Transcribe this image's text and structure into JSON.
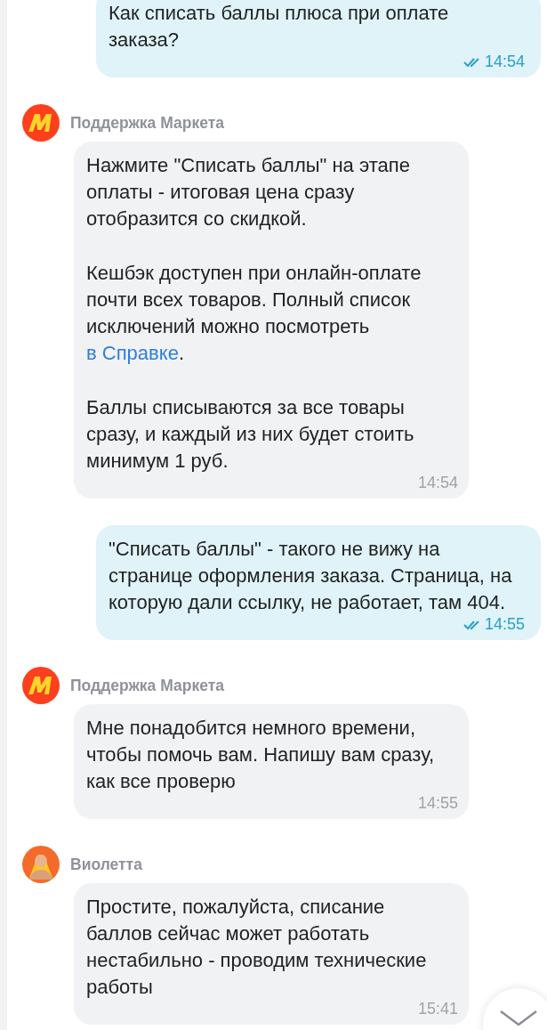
{
  "messages": [
    {
      "kind": "outgoing",
      "paragraphs": [
        [
          {
            "text": "Как списать баллы плюса при оплате заказа?"
          }
        ]
      ],
      "time": "14:54",
      "read": true
    },
    {
      "kind": "incoming",
      "sender": "Поддержка Маркета",
      "avatar": {
        "kind": "logo"
      },
      "paragraphs": [
        [
          {
            "text": "Нажмите \"Списать баллы\" на этапе оплаты - итоговая цена сразу отобразится со скидкой."
          }
        ],
        [
          {
            "text": "Кешбэк доступен при онлайн-оплате почти всех товаров. Полный список исключений можно посмотреть "
          },
          {
            "text": "в Справке",
            "kind": "link"
          },
          {
            "text": "."
          }
        ],
        [
          {
            "text": "Баллы списываются за все товары сразу, и каждый из них будет стоить минимум 1 руб."
          }
        ]
      ],
      "time": "14:54"
    },
    {
      "kind": "outgoing",
      "paragraphs": [
        [
          {
            "text": "\"Списать баллы\" - такого не вижу на странице оформления заказа. Страница, на которую дали ссылку, не работает, там 404."
          }
        ]
      ],
      "time": "14:55",
      "read": true
    },
    {
      "kind": "incoming",
      "sender": "Поддержка Маркета",
      "avatar": {
        "kind": "logo"
      },
      "paragraphs": [
        [
          {
            "text": "Мне понадобится немного времени, чтобы помочь вам. Напишу вам сразу, как все проверю"
          }
        ]
      ],
      "time": "14:55"
    },
    {
      "kind": "incoming",
      "sender": "Виолетта",
      "avatar": {
        "kind": "person"
      },
      "paragraphs": [
        [
          {
            "text": "Простите, пожалуйста, списание баллов сейчас может работать нестабильно - проводим технические работы"
          }
        ]
      ],
      "time": "15:41"
    }
  ]
}
